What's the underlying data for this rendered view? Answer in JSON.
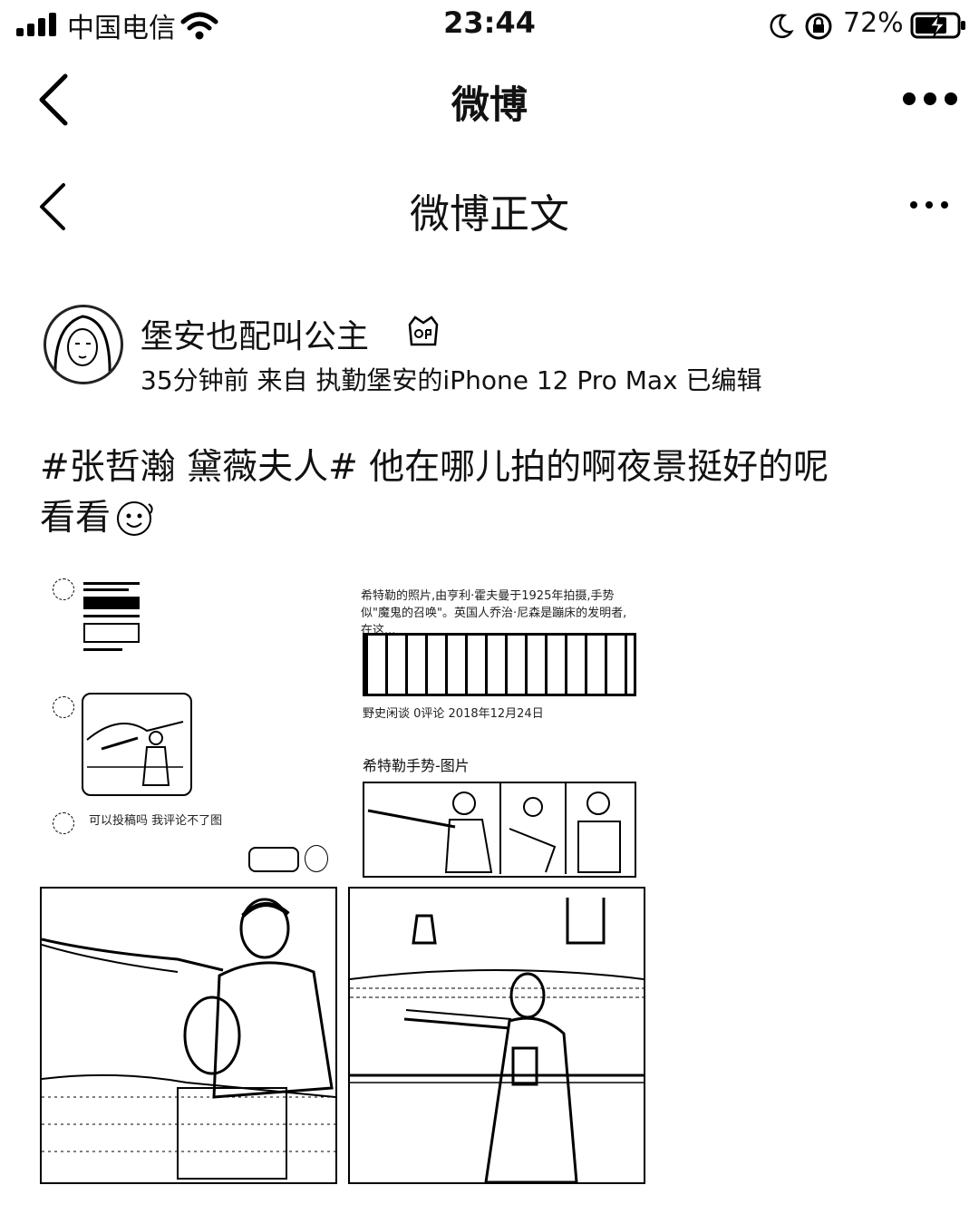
{
  "status_bar": {
    "carrier": "中国电信",
    "time": "23:44",
    "battery": "72%"
  },
  "nav1": {
    "title": "微博"
  },
  "nav2": {
    "title": "微博正文"
  },
  "post": {
    "username": "堡安也配叫公主",
    "meta": "35分钟前 来自 执勤堡安的iPhone 12 Pro Max 已编辑",
    "text_line1": "#张哲瀚 黛薇夫人# 他在哪儿拍的啊夜景挺好的呢",
    "text_line2": "看看"
  },
  "images": {
    "screenshot_caption": "希特勒的照片,由亨利·霍夫曼于1925年拍摄,手势似\"魔鬼的召唤\"。英国人乔治·尼森是蹦床的发明者,在这...",
    "screenshot_source": "野史闲谈  0评论  2018年12月24日",
    "screenshot_section": "希特勒手势-图片",
    "chat_text": "可以投稿吗 我评论不了图"
  },
  "colors": {
    "text": "#111111",
    "background": "#ffffff"
  }
}
